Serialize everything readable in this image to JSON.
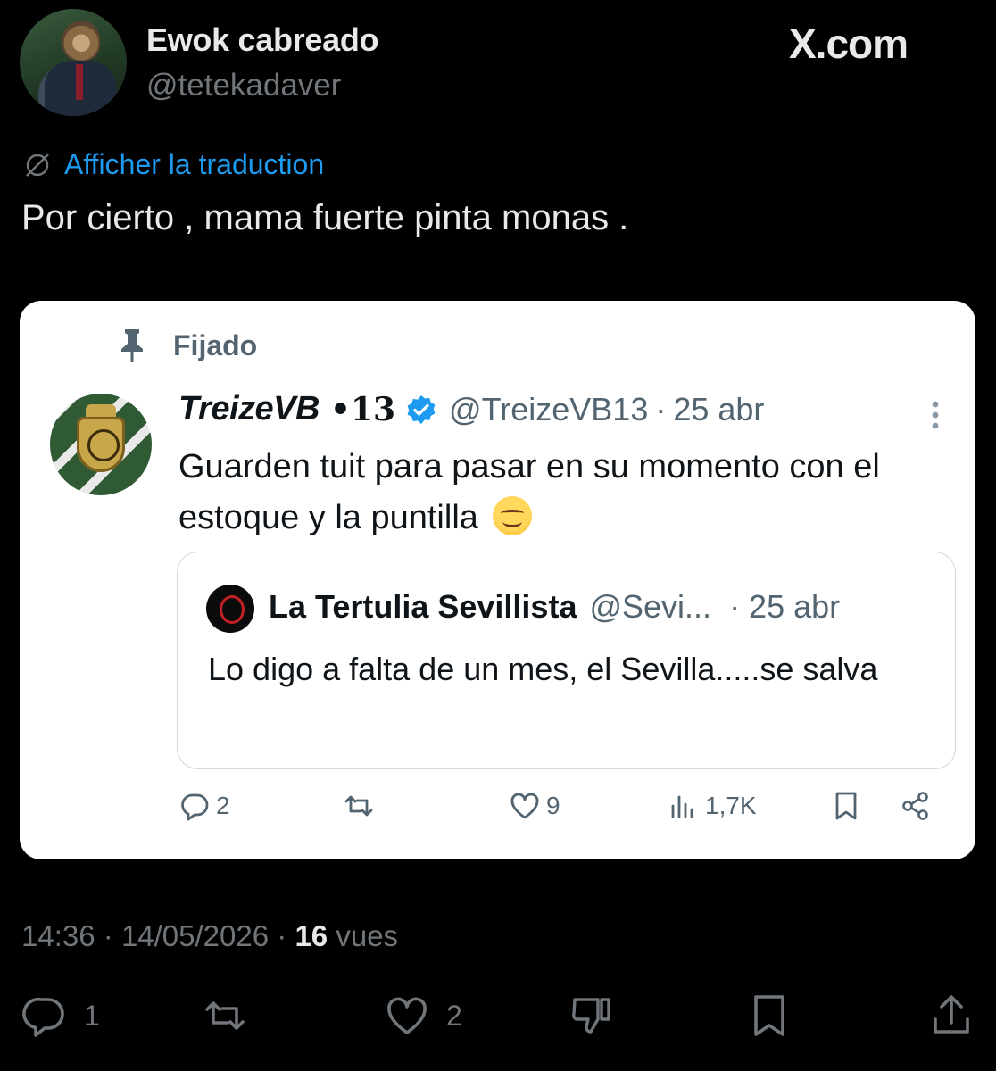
{
  "author": {
    "display_name": "Ewok cabreado",
    "handle": "@tetekadaver"
  },
  "brand": {
    "site_label": "X.com"
  },
  "translate": {
    "label": "Afficher la traduction",
    "icon": "translate-globe-icon"
  },
  "tweet": {
    "text": "Por cierto , mama fuerte pinta monas ."
  },
  "embedded": {
    "pinned_label": "Fijado",
    "author": {
      "name": "TreizeVB",
      "suffix": "•13",
      "handle": "@TreizeVB13",
      "separator": "·",
      "date": "25 abr"
    },
    "text": "Guarden tuit para pasar en su momento con el estoque y la puntilla",
    "quote": {
      "name": "La Tertulia Sevillista",
      "handle": "@Sevi...",
      "date": "· 25 abr",
      "text": "Lo digo a falta de un mes, el Sevilla.....se salva"
    },
    "actions": {
      "replies": "2",
      "likes": "9",
      "views": "1,7K"
    }
  },
  "footer": {
    "time": "14:36",
    "date": "14/05/2026",
    "sep": "·",
    "views_count": "16",
    "views_label": "vues"
  },
  "actions": {
    "replies": "1",
    "likes": "2"
  },
  "colors": {
    "background": "#000000",
    "link": "#1d9bf0",
    "muted": "#71767b",
    "card": "#ffffff",
    "verified": "#1d9bf0"
  }
}
